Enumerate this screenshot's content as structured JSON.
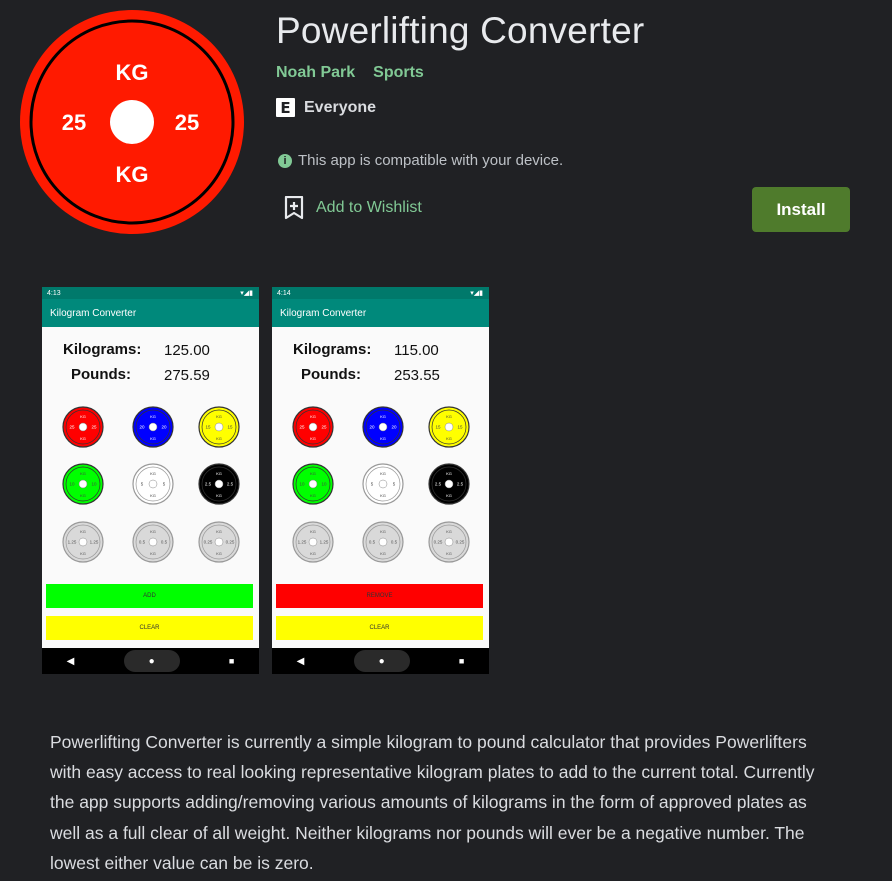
{
  "app": {
    "title": "Powerlifting Converter",
    "developer": "Noah Park",
    "category": "Sports",
    "rating": "Everyone",
    "rating_glyph": "E",
    "compat_icon": "i",
    "compatibility": "This app is compatible with your device.",
    "wishlist": "Add to Wishlist",
    "install": "Install"
  },
  "icon": {
    "top": "KG",
    "bottom": "KG",
    "left": "25",
    "right": "25",
    "plate_color": "#ff1a00"
  },
  "screenshots": [
    {
      "time": "4:13",
      "status_right": "▾◢▮",
      "title": "Kilogram Converter",
      "kg_label": "Kilograms:",
      "kg_value": "125.00",
      "lb_label": "Pounds:",
      "lb_value": "275.59",
      "button1": "ADD",
      "button1_color": "#00ff00",
      "button2": "CLEAR",
      "button2_color": "#ffff00"
    },
    {
      "time": "4:14",
      "status_right": "▾◢▮",
      "title": "Kilogram Converter",
      "kg_label": "Kilograms:",
      "kg_value": "115.00",
      "lb_label": "Pounds:",
      "lb_value": "253.55",
      "button1": "REMOVE",
      "button1_color": "#ff0000",
      "button2": "CLEAR",
      "button2_color": "#ffff00"
    }
  ],
  "plates": [
    {
      "color": "#ff0000",
      "text": "#ffffff",
      "num": "25"
    },
    {
      "color": "#0000ff",
      "text": "#ffffff",
      "num": "20"
    },
    {
      "color": "#ffff00",
      "text": "#444444",
      "num": "15"
    },
    {
      "color": "#00ff00",
      "text": "#444444",
      "num": "10"
    },
    {
      "color": "#ffffff",
      "text": "#444444",
      "num": "5"
    },
    {
      "color": "#000000",
      "text": "#ffffff",
      "num": "2.5"
    },
    {
      "color": "#d9d9d9",
      "text": "#555555",
      "num": "1.25"
    },
    {
      "color": "#d9d9d9",
      "text": "#555555",
      "num": "0.5"
    },
    {
      "color": "#d9d9d9",
      "text": "#555555",
      "num": "0.25"
    }
  ],
  "plate_unit": "KG",
  "nav": {
    "back": "◀",
    "home": "●",
    "recents": "■"
  },
  "description": "Powerlifting Converter is currently a simple kilogram to pound calculator that provides Powerlifters with easy access to real looking representative kilogram plates to add to the current total. Currently the app supports adding/removing various amounts of kilograms in the form of approved plates as well as a full clear of all weight. Neither kilograms nor pounds will ever be a negative number. The lowest either value can be is zero."
}
